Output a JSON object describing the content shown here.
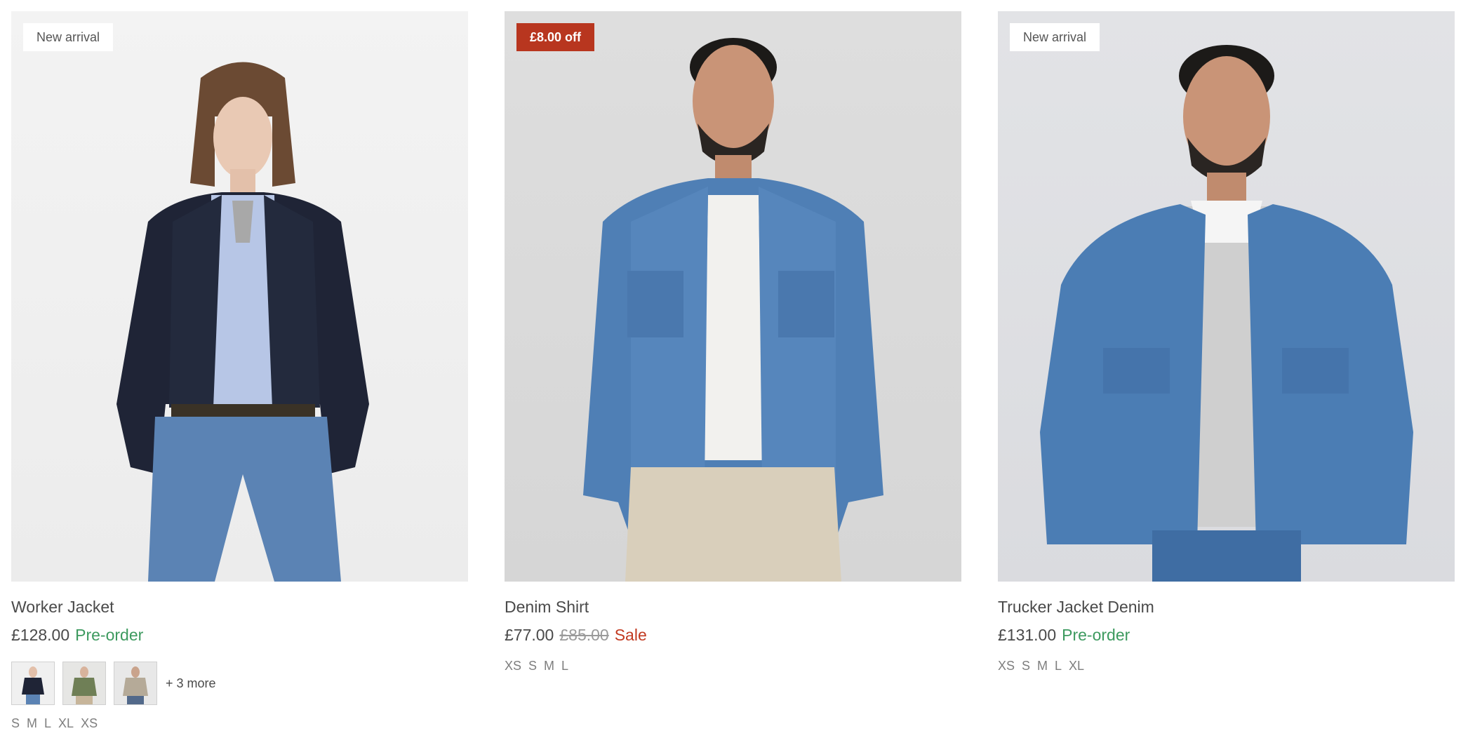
{
  "products": [
    {
      "badge": "New arrival",
      "title": "Worker Jacket",
      "price": "£128.00",
      "status": "Pre-order",
      "swatch_icons": [
        "swatch-navy-jacket",
        "swatch-olive-jacket",
        "swatch-beige-jacket"
      ],
      "more_label": "+ 3 more",
      "sizes": [
        "S",
        "M",
        "L",
        "XL",
        "XS"
      ]
    },
    {
      "badge": "£8.00 off",
      "title": "Denim Shirt",
      "price": "£77.00",
      "compare_price": "£85.00",
      "status": "Sale",
      "sizes": [
        "XS",
        "S",
        "M",
        "L"
      ]
    },
    {
      "badge": "New arrival",
      "title": "Trucker Jacket Denim",
      "price": "£131.00",
      "status": "Pre-order",
      "sizes": [
        "XS",
        "S",
        "M",
        "L",
        "XL"
      ]
    }
  ],
  "colors": {
    "sale_badge": "#b8361f",
    "preorder": "#3d9a5f",
    "sale_text": "#c23b22"
  }
}
